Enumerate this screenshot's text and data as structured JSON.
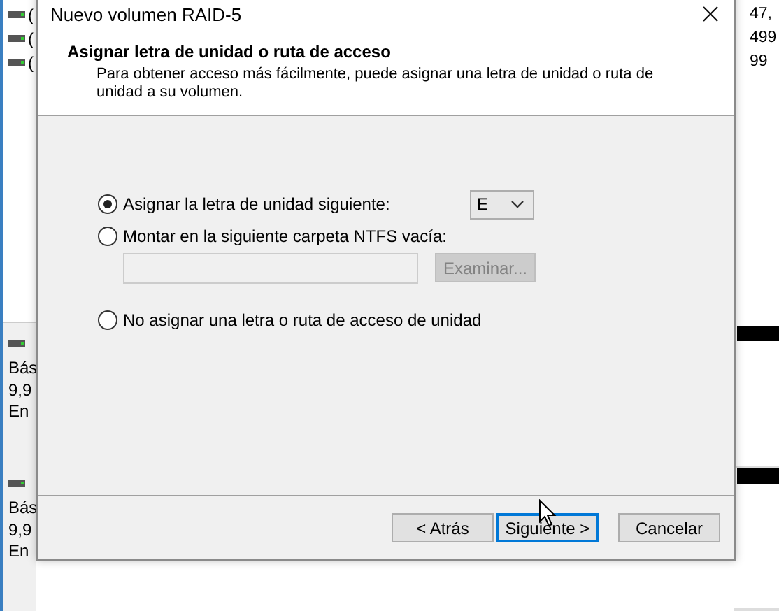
{
  "background": {
    "top_rows": [
      {
        "text": "(",
        "value": "47,"
      },
      {
        "text": "(",
        "value": "499"
      },
      {
        "text": "(",
        "value": "99"
      }
    ],
    "disks": [
      {
        "lines": [
          "Bás",
          "9,9",
          "En"
        ]
      },
      {
        "lines": [
          "Bás",
          "9,9",
          "En"
        ]
      }
    ]
  },
  "dialog": {
    "title": "Nuevo volumen RAID-5",
    "header": {
      "title": "Asignar letra de unidad o ruta de acceso",
      "description": "Para obtener acceso más fácilmente, puede asignar una letra de unidad o ruta de unidad a su volumen."
    },
    "options": [
      {
        "kind": "letter",
        "label": "Asignar la letra de unidad siguiente:",
        "selected": true
      },
      {
        "kind": "folder",
        "label": "Montar en la siguiente carpeta NTFS vacía:",
        "selected": false
      },
      {
        "kind": "none",
        "label": "No asignar una letra o ruta de acceso de unidad",
        "selected": false
      }
    ],
    "drive_letter": {
      "value": "E"
    },
    "folder_field": {
      "disabled": true
    },
    "browse_button": {
      "label": "Examinar...",
      "disabled": true
    },
    "buttons": [
      {
        "label": "< Atrás",
        "default": false
      },
      {
        "label": "Siguiente >",
        "default": true
      },
      {
        "label": "Cancelar",
        "default": false
      }
    ]
  }
}
